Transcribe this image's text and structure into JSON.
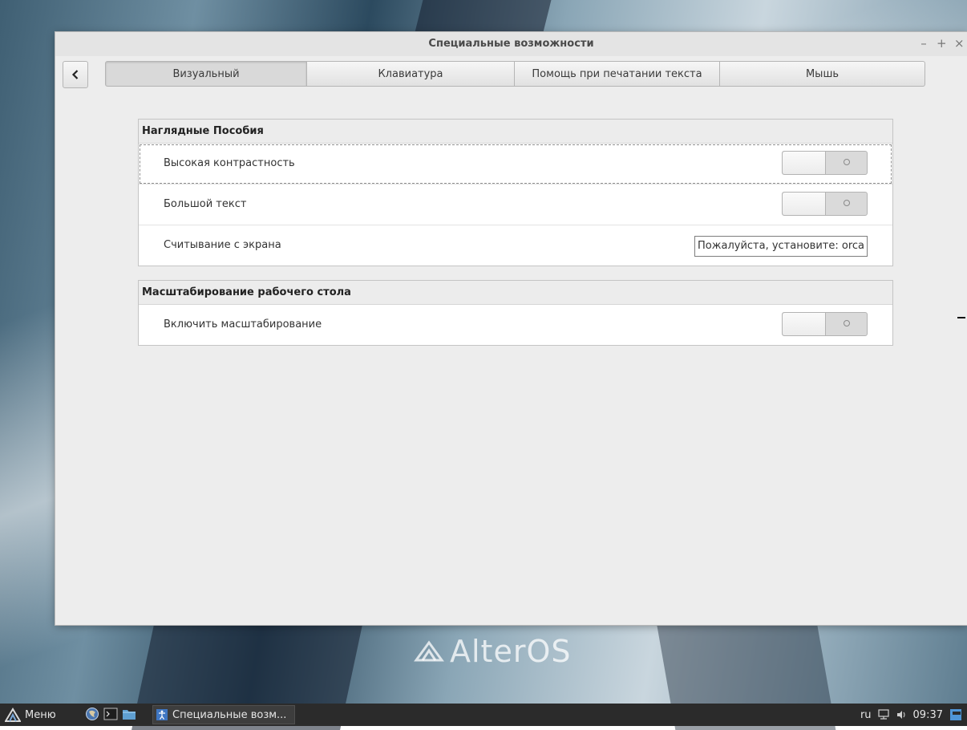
{
  "window": {
    "title": "Специальные возможности",
    "controls": [
      "–",
      "+",
      "×"
    ]
  },
  "tabs": [
    {
      "label": "Визуальный",
      "active": true
    },
    {
      "label": "Клавиатура",
      "active": false
    },
    {
      "label": "Помощь при печатании текста",
      "active": false
    },
    {
      "label": "Мышь",
      "active": false
    }
  ],
  "visual_aids": {
    "header": "Наглядные Пособия",
    "high_contrast": {
      "label": "Высокая контрастность",
      "state": "off"
    },
    "large_text": {
      "label": "Большой текст",
      "state": "off"
    },
    "screen_reader": {
      "label": "Считывание с экрана",
      "note": "Пожалуйста, установите: orca"
    }
  },
  "zoom": {
    "header": "Масштабирование рабочего стола",
    "enable_zoom": {
      "label": "Включить масштабирование",
      "state": "off"
    }
  },
  "desktop": {
    "brand_text": "AlterOS"
  },
  "taskbar": {
    "menu_label": "Меню",
    "task_label": "Специальные возм...",
    "keyboard_layout": "ru",
    "clock": "09:37"
  }
}
